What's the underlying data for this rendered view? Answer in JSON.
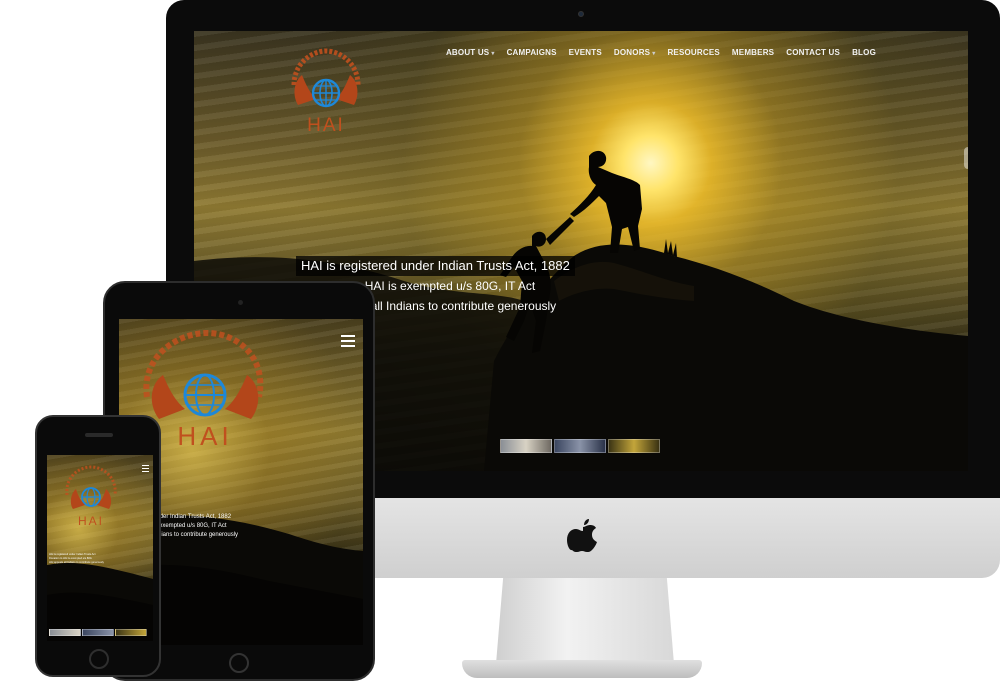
{
  "site": {
    "logo_text": "HAI",
    "logo_arc_text": "Humanitarian Aid International"
  },
  "nav": {
    "items": [
      {
        "label": "ABOUT US",
        "has_dropdown": true
      },
      {
        "label": "CAMPAIGNS",
        "has_dropdown": false
      },
      {
        "label": "EVENTS",
        "has_dropdown": false
      },
      {
        "label": "DONORS",
        "has_dropdown": true
      },
      {
        "label": "RESOURCES",
        "has_dropdown": false
      },
      {
        "label": "MEMBERS",
        "has_dropdown": false
      },
      {
        "label": "CONTACT US",
        "has_dropdown": false
      },
      {
        "label": "BLOG",
        "has_dropdown": false
      }
    ],
    "dropdown_glyph": "▾"
  },
  "hero": {
    "lines": [
      "HAI is registered under Indian Trusts Act, 1882",
      "Donation to HAI is exempted u/s 80G, IT Act",
      "HAI appeals all Indians to contribute generously"
    ],
    "slide_count": 3
  },
  "tablet": {
    "menu_icon": "hamburger-icon",
    "caption_lines": [
      "under Indian Trusts Act, 1882",
      "is exempted u/s 80G, IT Act",
      "Indians to contribute generously"
    ]
  },
  "phone": {
    "menu_icon": "hamburger-icon",
    "caption_lines": [
      "HAI is registered under Indian Trusts Act",
      "Donation to HAI is exempted u/s 80G",
      "HAI appeals all Indians to contribute generously"
    ]
  },
  "colors": {
    "logo_orange": "#c0501e",
    "globe_blue": "#1e88d8",
    "nav_text": "#f2f2f2",
    "caption_bg": "#000000"
  }
}
